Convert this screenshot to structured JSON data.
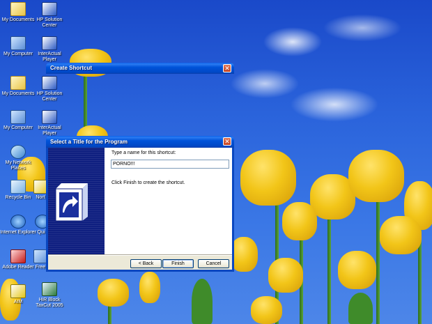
{
  "desktop": {
    "icons": [
      {
        "label": "My Documents",
        "icon": "folder-icon"
      },
      {
        "label": "HP Solution Center",
        "icon": "hp-icon"
      },
      {
        "label": "My Computer",
        "icon": "computer-icon"
      },
      {
        "label": "InterActual Player",
        "icon": "player-icon"
      },
      {
        "label": "My Documents",
        "icon": "folder-icon"
      },
      {
        "label": "HP Solution Center",
        "icon": "hp-icon"
      },
      {
        "label": "My Computer",
        "icon": "computer-icon"
      },
      {
        "label": "InterActual Player",
        "icon": "player-icon"
      },
      {
        "label": "My Network Places",
        "icon": "network-icon"
      },
      {
        "label": "Recycle Bin",
        "icon": "recycle-bin-icon"
      },
      {
        "label": "Nort",
        "icon": "norton-icon"
      },
      {
        "label": "Internet Explorer",
        "icon": "ie-icon"
      },
      {
        "label": "Qui",
        "icon": "quicktime-icon"
      },
      {
        "label": "Adobe Reader",
        "icon": "pdf-icon"
      },
      {
        "label": "Free",
        "icon": "app-icon"
      },
      {
        "label": "AIM",
        "icon": "aim-icon"
      },
      {
        "label": "HiR Block TaxCut 2005",
        "icon": "taxcut-icon"
      }
    ]
  },
  "ghost_window": {
    "title": "Create Shortcut"
  },
  "dialog": {
    "title": "Select a Title for the Program",
    "prompt": "Type a name for this shortcut:",
    "name_value": "PORNO!!!",
    "finish_text": "Click Finish to create the shortcut.",
    "buttons": {
      "back": "< Back",
      "finish": "Finish",
      "cancel": "Cancel"
    },
    "close_glyph": "✕"
  },
  "colors": {
    "title_blue": "#0053d9",
    "dialog_face": "#ece9d8",
    "side_panel": "#0f1f80"
  }
}
